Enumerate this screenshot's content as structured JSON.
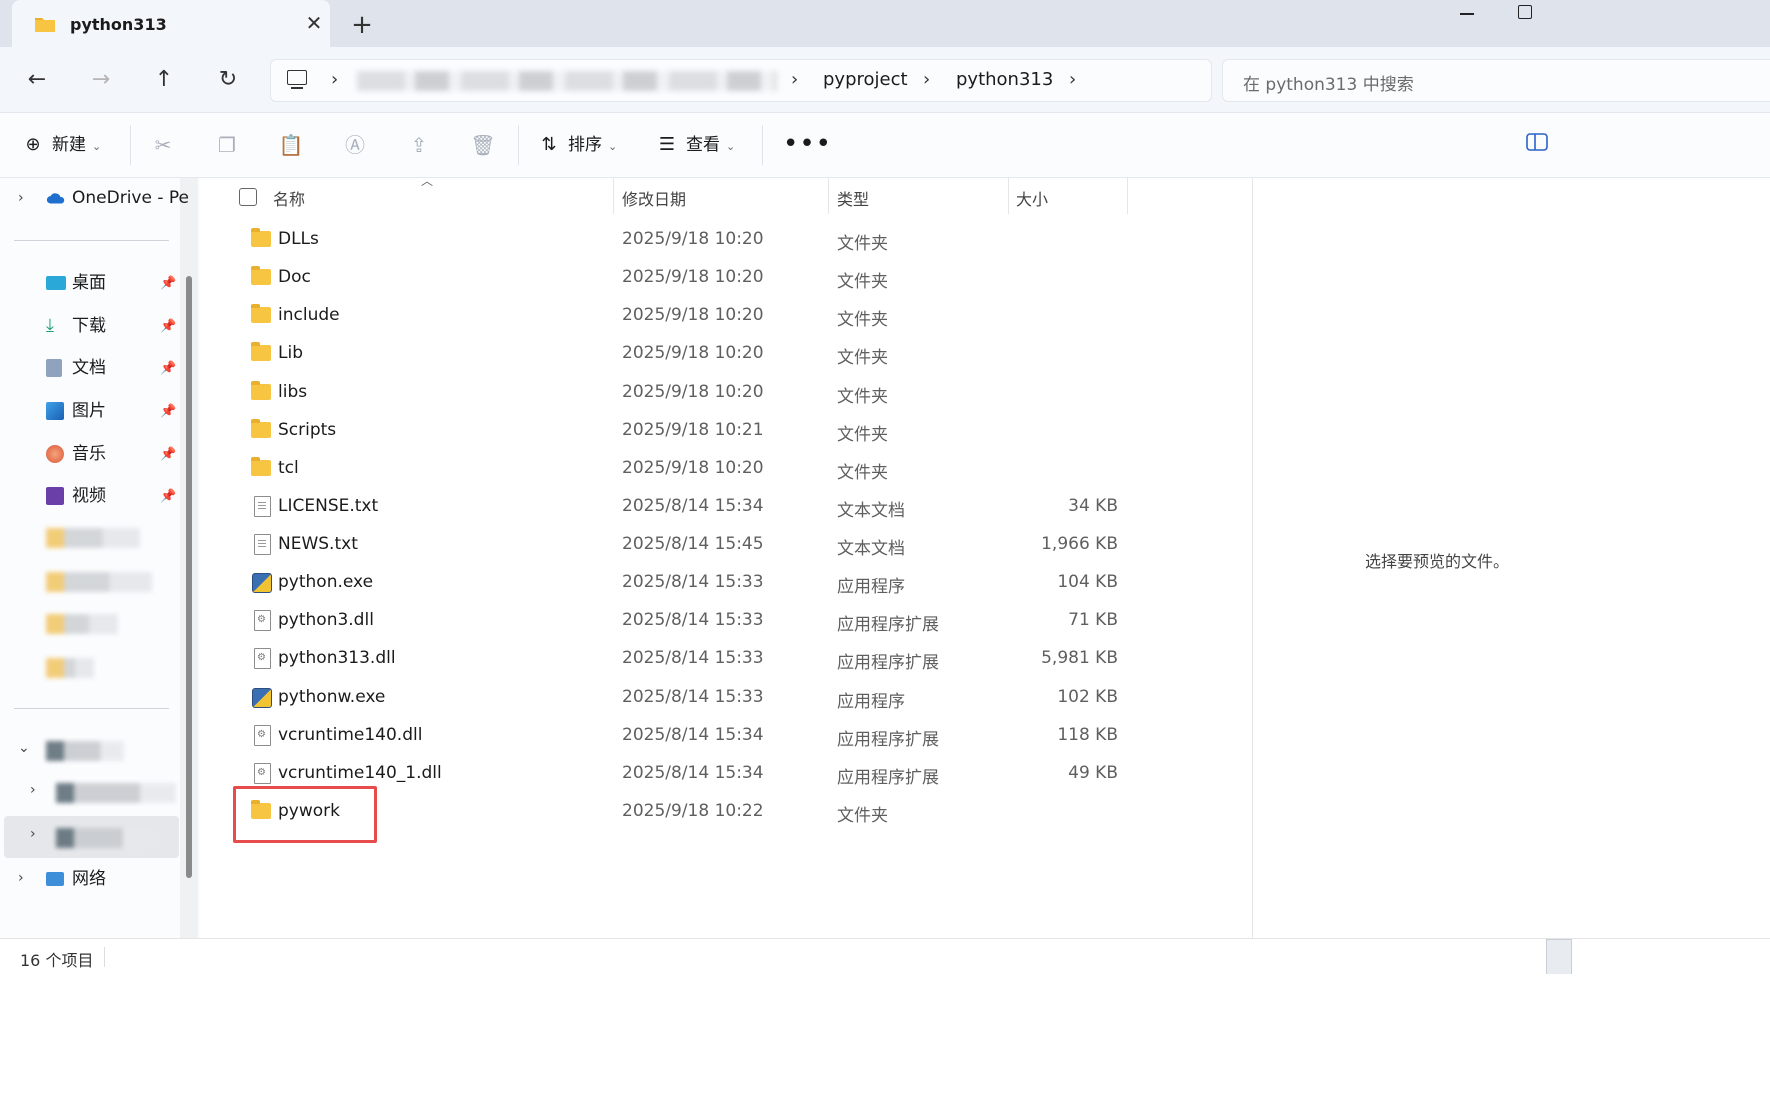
{
  "tab": {
    "title": "python313",
    "close": "✕",
    "new": "+"
  },
  "nav": {
    "back": "←",
    "forward": "→",
    "up": "↑",
    "refresh": "↻",
    "breadcrumbs": [
      "pyproject",
      "python313"
    ],
    "search_placeholder": "在 python313 中搜索"
  },
  "toolbar": {
    "new_label": "新建",
    "sort_label": "排序",
    "view_label": "查看",
    "more": "•••",
    "icons": [
      "cut-icon",
      "copy-icon",
      "paste-icon",
      "rename-icon",
      "share-icon",
      "delete-icon"
    ]
  },
  "sidebar": {
    "onedrive": "OneDrive - Pe",
    "quick": [
      {
        "label": "桌面",
        "icon": "desktop-icon"
      },
      {
        "label": "下载",
        "icon": "download-icon"
      },
      {
        "label": "文档",
        "icon": "documents-icon"
      },
      {
        "label": "图片",
        "icon": "pictures-icon"
      },
      {
        "label": "音乐",
        "icon": "music-icon"
      },
      {
        "label": "视频",
        "icon": "videos-icon"
      }
    ],
    "network": "网络"
  },
  "columns": {
    "name": "名称",
    "date": "修改日期",
    "type": "类型",
    "size": "大小"
  },
  "files": [
    {
      "name": "DLLs",
      "date": "2025/9/18 10:20",
      "type": "文件夹",
      "size": "",
      "icon": "folder"
    },
    {
      "name": "Doc",
      "date": "2025/9/18 10:20",
      "type": "文件夹",
      "size": "",
      "icon": "folder"
    },
    {
      "name": "include",
      "date": "2025/9/18 10:20",
      "type": "文件夹",
      "size": "",
      "icon": "folder"
    },
    {
      "name": "Lib",
      "date": "2025/9/18 10:20",
      "type": "文件夹",
      "size": "",
      "icon": "folder"
    },
    {
      "name": "libs",
      "date": "2025/9/18 10:20",
      "type": "文件夹",
      "size": "",
      "icon": "folder"
    },
    {
      "name": "Scripts",
      "date": "2025/9/18 10:21",
      "type": "文件夹",
      "size": "",
      "icon": "folder"
    },
    {
      "name": "tcl",
      "date": "2025/9/18 10:20",
      "type": "文件夹",
      "size": "",
      "icon": "folder"
    },
    {
      "name": "LICENSE.txt",
      "date": "2025/8/14 15:34",
      "type": "文本文档",
      "size": "34 KB",
      "icon": "doc"
    },
    {
      "name": "NEWS.txt",
      "date": "2025/8/14 15:45",
      "type": "文本文档",
      "size": "1,966 KB",
      "icon": "doc"
    },
    {
      "name": "python.exe",
      "date": "2025/8/14 15:33",
      "type": "应用程序",
      "size": "104 KB",
      "icon": "exe"
    },
    {
      "name": "python3.dll",
      "date": "2025/8/14 15:33",
      "type": "应用程序扩展",
      "size": "71 KB",
      "icon": "dll"
    },
    {
      "name": "python313.dll",
      "date": "2025/8/14 15:33",
      "type": "应用程序扩展",
      "size": "5,981 KB",
      "icon": "dll"
    },
    {
      "name": "pythonw.exe",
      "date": "2025/8/14 15:33",
      "type": "应用程序",
      "size": "102 KB",
      "icon": "exe"
    },
    {
      "name": "vcruntime140.dll",
      "date": "2025/8/14 15:34",
      "type": "应用程序扩展",
      "size": "118 KB",
      "icon": "dll"
    },
    {
      "name": "vcruntime140_1.dll",
      "date": "2025/8/14 15:34",
      "type": "应用程序扩展",
      "size": "49 KB",
      "icon": "dll"
    },
    {
      "name": "pywork",
      "date": "2025/9/18 10:22",
      "type": "文件夹",
      "size": "",
      "icon": "folder"
    }
  ],
  "preview": {
    "empty_text": "选择要预览的文件。"
  },
  "status": {
    "count": "16 个项目"
  }
}
